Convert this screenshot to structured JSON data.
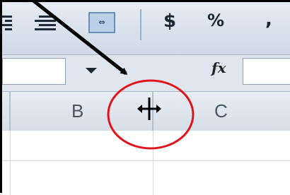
{
  "toolbar": {
    "buttons": [
      {
        "name": "align-center-icon"
      },
      {
        "name": "align-right-icon"
      },
      {
        "name": "merge-and-center-icon"
      }
    ],
    "currency_symbol": "$",
    "percent_symbol": "%",
    "comma_symbol": ","
  },
  "formula_bar": {
    "name_box_value": "",
    "fx_label": "fx",
    "formula_value": ""
  },
  "columns": [
    "B",
    "C"
  ],
  "annotation": {
    "circle_color": "#e0141b",
    "arrow_color": "#000000",
    "cursor_icon": "column-resize-cursor-icon"
  }
}
